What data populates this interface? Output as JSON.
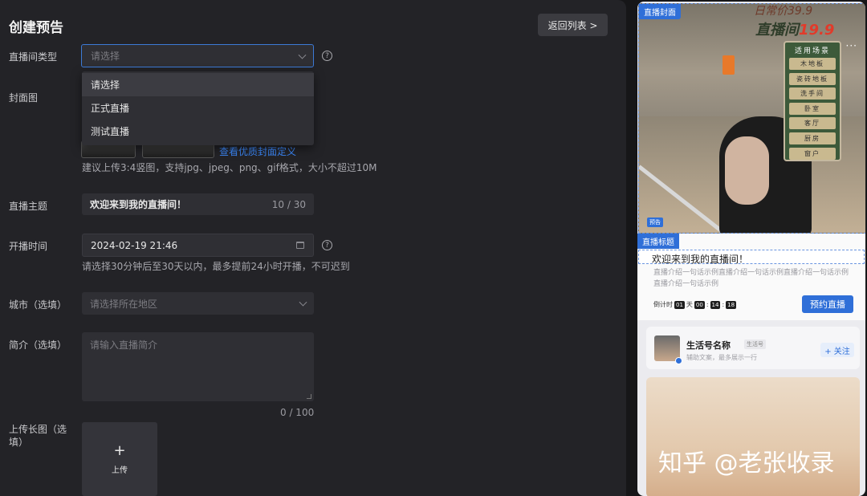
{
  "form": {
    "title": "创建预告",
    "back_button": "返回列表 >",
    "room_type": {
      "label": "直播间类型",
      "placeholder": "请选择",
      "options": [
        "请选择",
        "正式直播",
        "测试直播"
      ]
    },
    "cover": {
      "label": "封面图",
      "link": "查看优质封面定义",
      "hint": "建议上传3:4竖图，支持jpg、jpeg、png、gif格式，大小不超过10M"
    },
    "topic": {
      "label": "直播主题",
      "value": "欢迎来到我的直播间！",
      "count": "10 / 30"
    },
    "start_time": {
      "label": "开播时间",
      "value": "2024-02-19 21:46",
      "hint": "请选择30分钟后至30天以内，最多提前24小时开播，不可迟到"
    },
    "city": {
      "label": "城市（选填）",
      "placeholder": "请选择所在地区"
    },
    "intro": {
      "label": "简介（选填）",
      "placeholder": "请输入直播简介",
      "count": "0 / 100"
    },
    "long_image": {
      "label": "上传长图（选填）",
      "plus": "+",
      "upload_text": "上传"
    },
    "help_glyph": "?"
  },
  "preview": {
    "cover_tag": "直播封面",
    "cover_price_top": "日常价39.9",
    "cover_price_label": "直播间",
    "cover_price_value": "19.9",
    "cover_more": "···",
    "scene_title": "适用场景",
    "scene_items": [
      "木地板",
      "瓷砖地板",
      "洗手间",
      "卧室",
      "客厅",
      "厨房",
      "窗户"
    ],
    "cover_badge": "预告",
    "live_tag": "直播标题",
    "live_title": "欢迎来到我的直播间！",
    "live_desc": "直播介绍一句话示例直播介绍一句话示例直播介绍一句话示例直播介绍一句话示例",
    "countdown_label": "倒计时",
    "countdown": {
      "days": "01",
      "day_unit": "天",
      "hours": "00",
      "minutes": "14",
      "seconds": "18"
    },
    "reserve_button": "预约直播",
    "account_name": "生活号名称",
    "account_tag": "生活号",
    "account_sub": "辅助文案，最多展示一行",
    "follow_button": "+ 关注"
  },
  "watermark": "知乎 @老张收录",
  "colors": {
    "accent": "#2f6fd8",
    "link": "#3d8bff",
    "price": "#e23a2a"
  }
}
